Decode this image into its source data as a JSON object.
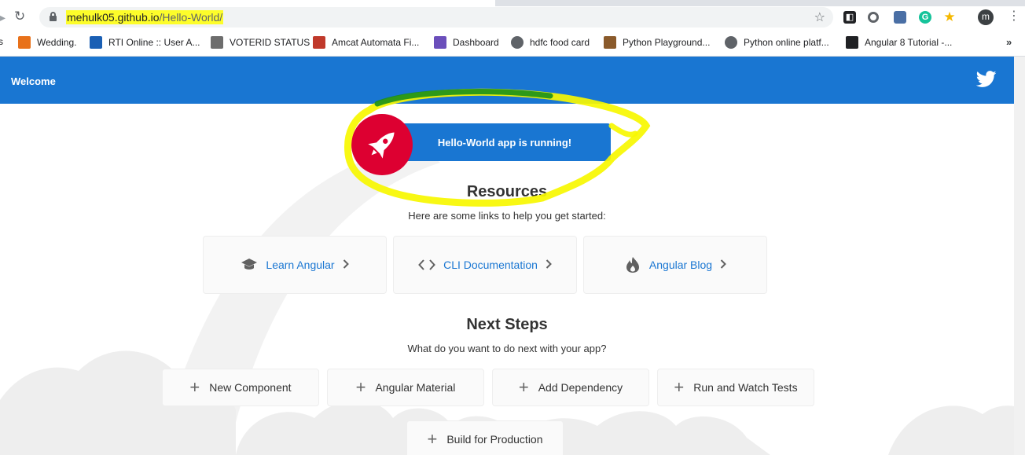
{
  "browser": {
    "url_host": "mehulk05.github.io",
    "url_path": "/Hello-World/",
    "avatar_letter": "m",
    "bookmarks": [
      {
        "label": "Wedding.",
        "color": "#e8711a"
      },
      {
        "label": "RTI Online :: User A...",
        "color": "#1a5fb4"
      },
      {
        "label": "VOTERID STATUS",
        "color": "#6d6d6d"
      },
      {
        "label": "Amcat Automata Fi...",
        "color": "#c0392b"
      },
      {
        "label": "Dashboard",
        "color": "#6b4fbb"
      },
      {
        "label": "hdfc food card",
        "color": "#5f6368"
      },
      {
        "label": "Python Playground...",
        "color": "#8a5a2b"
      },
      {
        "label": "Python online platf...",
        "color": "#5f6368"
      },
      {
        "label": "Angular 8 Tutorial -...",
        "color": "#202124"
      }
    ],
    "bookmarks_more": "»"
  },
  "app": {
    "title": "Welcome",
    "running_text": "Hello-World app is running!",
    "resources_title": "Resources",
    "resources_sub": "Here are some links to help you get started:",
    "resources": [
      {
        "label": "Learn Angular",
        "icon": "graduation-cap-icon"
      },
      {
        "label": "CLI Documentation",
        "icon": "code-brackets-icon"
      },
      {
        "label": "Angular Blog",
        "icon": "flame-icon"
      }
    ],
    "next_title": "Next Steps",
    "next_sub": "What do you want to do next with your app?",
    "next_steps": [
      {
        "label": "New Component"
      },
      {
        "label": "Angular Material"
      },
      {
        "label": "Add Dependency"
      },
      {
        "label": "Run and Watch Tests"
      },
      {
        "label": "Build for Production"
      }
    ],
    "brand_blue": "#1976d2",
    "angular_red": "#dd0031",
    "highlight_yellow": "#fdfd2a"
  }
}
